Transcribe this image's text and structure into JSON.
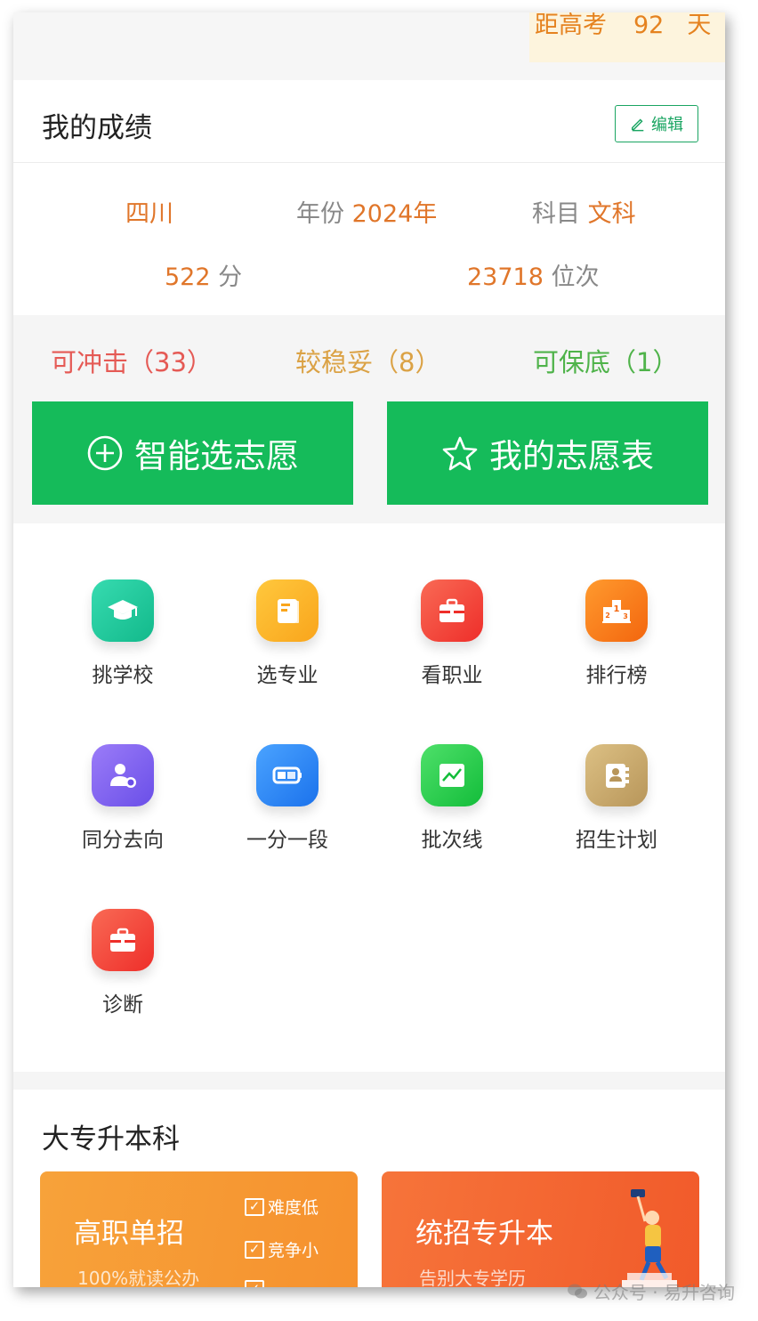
{
  "countdown": {
    "prefix": "距高考",
    "days": "92",
    "unit": "天"
  },
  "score_section": {
    "title": "我的成绩",
    "edit_label": "编辑",
    "province": "四川",
    "year_label": "年份",
    "year_value": "2024年",
    "subject_label": "科目",
    "subject_value": "文科",
    "score_value": "522",
    "score_unit": "分",
    "rank_value": "23718",
    "rank_unit": "位次"
  },
  "chances": {
    "reach": "可冲击（33）",
    "stable": "较稳妥（8）",
    "safe": "可保底（1）"
  },
  "buttons": {
    "smart_select": "智能选志愿",
    "my_table": "我的志愿表"
  },
  "grid": [
    {
      "label": "挑学校",
      "icon": "graduation-cap-icon",
      "color": "#1ec99a"
    },
    {
      "label": "选专业",
      "icon": "book-icon",
      "color": "#fbb42a"
    },
    {
      "label": "看职业",
      "icon": "briefcase-icon",
      "color": "#f4453c"
    },
    {
      "label": "排行榜",
      "icon": "podium-icon",
      "color": "#f77a1c"
    },
    {
      "label": "同分去向",
      "icon": "person-icon",
      "color": "#7d63ef"
    },
    {
      "label": "一分一段",
      "icon": "battery-icon",
      "color": "#2f86f6"
    },
    {
      "label": "批次线",
      "icon": "trend-chart-icon",
      "color": "#26c84f"
    },
    {
      "label": "招生计划",
      "icon": "contact-book-icon",
      "color": "#c8a766"
    },
    {
      "label": "诊断",
      "icon": "briefcase-icon",
      "color": "#f4453c"
    }
  ],
  "upgrade": {
    "title": "大专升本科",
    "card1": {
      "title": "高职单招",
      "subtitle": "100%就读公办",
      "tag1": "难度低",
      "tag2": "竞争小"
    },
    "card2": {
      "title": "统招专升本",
      "subtitle": "告别大专学历"
    }
  },
  "watermark": "公众号 · 易升咨询"
}
